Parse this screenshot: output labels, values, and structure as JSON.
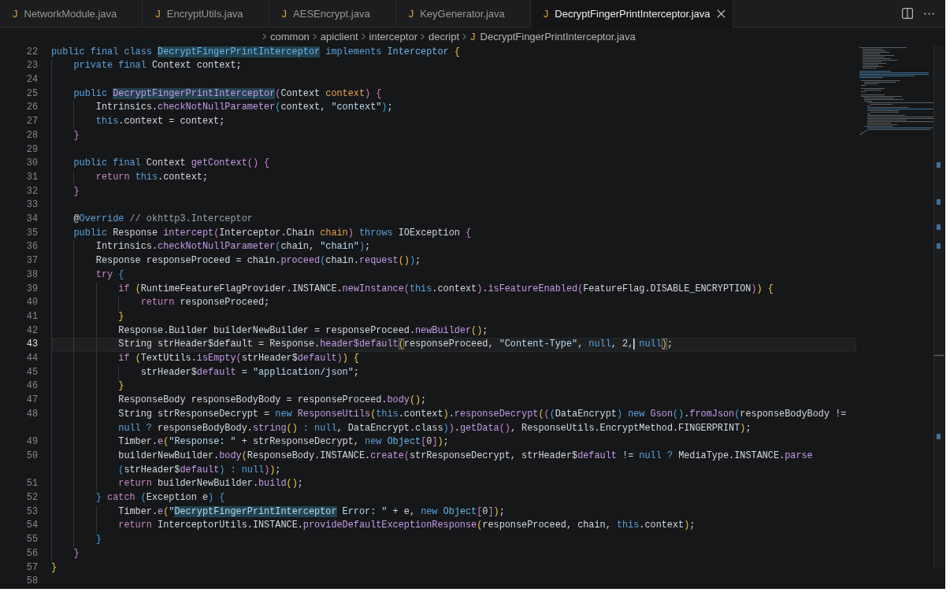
{
  "tabs": [
    {
      "file_icon": "J",
      "label": "NetworkModule.java",
      "selected": false
    },
    {
      "file_icon": "J",
      "label": "EncryptUtils.java",
      "selected": false
    },
    {
      "file_icon": "J",
      "label": "AESEncrypt.java",
      "selected": false
    },
    {
      "file_icon": "J",
      "label": "KeyGenerator.java",
      "selected": false
    },
    {
      "file_icon": "J",
      "label": "DecryptFingerPrintInterceptor.java",
      "selected": true
    }
  ],
  "breadcrumbs": [
    {
      "label": "common"
    },
    {
      "label": "apiclient"
    },
    {
      "label": "interceptor"
    },
    {
      "label": "decript"
    },
    {
      "file_icon": "J",
      "label": "DecryptFingerPrintInterceptor.java"
    }
  ],
  "editor": {
    "lines": [
      {
        "number": "22",
        "current": false,
        "rows": [
          {
            "tokens": [
              {
                "text": "public final class ",
                "kind": "keyword"
              },
              {
                "text": "DecryptFingerPrintInterceptor",
                "kind": "type",
                "highlighted": true
              },
              {
                "text": " implements ",
                "kind": "keyword"
              },
              {
                "text": "Interceptor ",
                "kind": "type"
              },
              {
                "text": "{",
                "kind": "bracket1"
              }
            ]
          }
        ]
      },
      {
        "number": "23",
        "current": false,
        "rows": [
          {
            "tokens": [
              {
                "text": "    private final ",
                "kind": "keyword"
              },
              {
                "text": "Context context;",
                "kind": "plain"
              }
            ]
          }
        ]
      },
      {
        "number": "24",
        "current": false
      },
      {
        "number": "25",
        "current": false,
        "rows": [
          {
            "tokens": [
              {
                "text": "    public ",
                "kind": "keyword"
              },
              {
                "text": "DecryptFingerPrintInterceptor",
                "kind": "function",
                "highlighted": true
              },
              {
                "text": "(",
                "kind": "bracket2"
              },
              {
                "text": "Context ",
                "kind": "plain"
              },
              {
                "text": "context",
                "kind": "param"
              },
              {
                "text": ") {",
                "kind": "bracket2"
              }
            ]
          }
        ]
      },
      {
        "number": "26",
        "current": false,
        "rows": [
          {
            "tokens": [
              {
                "text": "        Intrinsics.",
                "kind": "plain"
              },
              {
                "text": "checkNotNullParameter",
                "kind": "function"
              },
              {
                "text": "(",
                "kind": "bracket3"
              },
              {
                "text": "context, ",
                "kind": "plain"
              },
              {
                "text": "\"context\"",
                "kind": "string"
              },
              {
                "text": ")",
                "kind": "bracket3"
              },
              {
                "text": ";",
                "kind": "plain"
              }
            ]
          }
        ]
      },
      {
        "number": "27",
        "current": false,
        "rows": [
          {
            "tokens": [
              {
                "text": "        this",
                "kind": "keyword"
              },
              {
                "text": ".context = context;",
                "kind": "plain"
              }
            ]
          }
        ]
      },
      {
        "number": "28",
        "current": false,
        "rows": [
          {
            "tokens": [
              {
                "text": "    }",
                "kind": "bracket2"
              }
            ]
          }
        ]
      },
      {
        "number": "29",
        "current": false
      },
      {
        "number": "30",
        "current": false,
        "rows": [
          {
            "tokens": [
              {
                "text": "    public final ",
                "kind": "keyword"
              },
              {
                "text": "Context ",
                "kind": "plain"
              },
              {
                "text": "getContext",
                "kind": "function"
              },
              {
                "text": "() {",
                "kind": "bracket2"
              }
            ]
          }
        ]
      },
      {
        "number": "31",
        "current": false,
        "rows": [
          {
            "tokens": [
              {
                "text": "        return ",
                "kind": "control"
              },
              {
                "text": "this",
                "kind": "keyword"
              },
              {
                "text": ".context;",
                "kind": "plain"
              }
            ]
          }
        ]
      },
      {
        "number": "32",
        "current": false,
        "rows": [
          {
            "tokens": [
              {
                "text": "    }",
                "kind": "bracket2"
              }
            ]
          }
        ]
      },
      {
        "number": "33",
        "current": false
      },
      {
        "number": "34",
        "current": false,
        "rows": [
          {
            "tokens": [
              {
                "text": "    @",
                "kind": "plain"
              },
              {
                "text": "Override ",
                "kind": "keyword"
              },
              {
                "text": "// okhttp3.Interceptor",
                "kind": "comment"
              }
            ]
          }
        ]
      },
      {
        "number": "35",
        "current": false,
        "rows": [
          {
            "tokens": [
              {
                "text": "    public ",
                "kind": "keyword"
              },
              {
                "text": "Response ",
                "kind": "plain"
              },
              {
                "text": "intercept",
                "kind": "function"
              },
              {
                "text": "(",
                "kind": "bracket2"
              },
              {
                "text": "Interceptor.Chain ",
                "kind": "plain"
              },
              {
                "text": "chain",
                "kind": "param"
              },
              {
                "text": ")",
                "kind": "bracket2"
              },
              {
                "text": " throws ",
                "kind": "keyword"
              },
              {
                "text": "IOException ",
                "kind": "plain"
              },
              {
                "text": "{",
                "kind": "bracket2"
              }
            ]
          }
        ]
      },
      {
        "number": "36",
        "current": false,
        "rows": [
          {
            "tokens": [
              {
                "text": "        Intrinsics.",
                "kind": "plain"
              },
              {
                "text": "checkNotNullParameter",
                "kind": "function"
              },
              {
                "text": "(",
                "kind": "bracket3"
              },
              {
                "text": "chain, ",
                "kind": "plain"
              },
              {
                "text": "\"chain\"",
                "kind": "string"
              },
              {
                "text": ")",
                "kind": "bracket3"
              },
              {
                "text": ";",
                "kind": "plain"
              }
            ]
          }
        ]
      },
      {
        "number": "37",
        "current": false,
        "rows": [
          {
            "tokens": [
              {
                "text": "        Response responseProceed = chain.",
                "kind": "plain"
              },
              {
                "text": "proceed",
                "kind": "function"
              },
              {
                "text": "(",
                "kind": "bracket3"
              },
              {
                "text": "chain.",
                "kind": "plain"
              },
              {
                "text": "request",
                "kind": "function"
              },
              {
                "text": "()",
                "kind": "bracket1"
              },
              {
                "text": ")",
                "kind": "bracket3"
              },
              {
                "text": ";",
                "kind": "plain"
              }
            ]
          }
        ]
      },
      {
        "number": "38",
        "current": false,
        "rows": [
          {
            "tokens": [
              {
                "text": "        try ",
                "kind": "control"
              },
              {
                "text": "{",
                "kind": "bracket3"
              }
            ]
          }
        ]
      },
      {
        "number": "39",
        "current": false,
        "rows": [
          {
            "tokens": [
              {
                "text": "            if ",
                "kind": "control"
              },
              {
                "text": "(",
                "kind": "bracket1"
              },
              {
                "text": "RuntimeFeatureFlagProvider.INSTANCE.",
                "kind": "plain"
              },
              {
                "text": "newInstance",
                "kind": "function"
              },
              {
                "text": "(",
                "kind": "bracket2"
              },
              {
                "text": "this",
                "kind": "keyword"
              },
              {
                "text": ".context",
                "kind": "plain"
              },
              {
                "text": ")",
                "kind": "bracket2"
              },
              {
                "text": ".",
                "kind": "plain"
              },
              {
                "text": "isFeatureEnabled",
                "kind": "function"
              },
              {
                "text": "(",
                "kind": "bracket2"
              },
              {
                "text": "FeatureFlag.DISABLE_ENCRYPTION",
                "kind": "plain"
              },
              {
                "text": ")",
                "kind": "bracket2"
              },
              {
                "text": ") {",
                "kind": "bracket1"
              }
            ]
          }
        ]
      },
      {
        "number": "40",
        "current": false,
        "rows": [
          {
            "tokens": [
              {
                "text": "                return ",
                "kind": "control"
              },
              {
                "text": "responseProceed;",
                "kind": "plain"
              }
            ]
          }
        ]
      },
      {
        "number": "41",
        "current": false,
        "rows": [
          {
            "tokens": [
              {
                "text": "            }",
                "kind": "bracket1"
              }
            ]
          }
        ]
      },
      {
        "number": "42",
        "current": false,
        "rows": [
          {
            "tokens": [
              {
                "text": "            Response.Builder builderNewBuilder = responseProceed.",
                "kind": "plain"
              },
              {
                "text": "newBuilder",
                "kind": "function"
              },
              {
                "text": "()",
                "kind": "bracket1"
              },
              {
                "text": ";",
                "kind": "plain"
              }
            ]
          }
        ]
      },
      {
        "number": "43",
        "current": true,
        "rows": [
          {
            "tokens": [
              {
                "text": "            String strHeader$default = Response.",
                "kind": "plain"
              },
              {
                "text": "header$default",
                "kind": "function"
              },
              {
                "text": "(",
                "kind": "bracket1",
                "matched": true
              },
              {
                "text": "responseProceed, ",
                "kind": "plain"
              },
              {
                "text": "\"Content-Type\"",
                "kind": "string"
              },
              {
                "text": ", ",
                "kind": "plain"
              },
              {
                "text": "null",
                "kind": "keyword"
              },
              {
                "text": ", 2,",
                "kind": "plain"
              },
              {
                "text": " null",
                "kind": "keyword",
                "cursor": true
              },
              {
                "text": ")",
                "kind": "bracket1",
                "matched": true
              },
              {
                "text": ";",
                "kind": "plain"
              }
            ]
          }
        ]
      },
      {
        "number": "44",
        "current": false,
        "rows": [
          {
            "tokens": [
              {
                "text": "            if ",
                "kind": "control"
              },
              {
                "text": "(",
                "kind": "bracket1"
              },
              {
                "text": "TextUtils.",
                "kind": "plain"
              },
              {
                "text": "isEmpty",
                "kind": "function"
              },
              {
                "text": "(",
                "kind": "bracket2"
              },
              {
                "text": "strHeader$",
                "kind": "plain"
              },
              {
                "text": "default",
                "kind": "function"
              },
              {
                "text": ")",
                "kind": "bracket2"
              },
              {
                "text": ") {",
                "kind": "bracket1"
              }
            ]
          }
        ]
      },
      {
        "number": "45",
        "current": false,
        "rows": [
          {
            "tokens": [
              {
                "text": "                strHeader$",
                "kind": "plain"
              },
              {
                "text": "default",
                "kind": "function"
              },
              {
                "text": " = ",
                "kind": "plain"
              },
              {
                "text": "\"application/json\"",
                "kind": "string"
              },
              {
                "text": ";",
                "kind": "plain"
              }
            ]
          }
        ]
      },
      {
        "number": "46",
        "current": false,
        "rows": [
          {
            "tokens": [
              {
                "text": "            }",
                "kind": "bracket1"
              }
            ]
          }
        ]
      },
      {
        "number": "47",
        "current": false,
        "rows": [
          {
            "tokens": [
              {
                "text": "            ResponseBody responseBodyBody = responseProceed.",
                "kind": "plain"
              },
              {
                "text": "body",
                "kind": "function"
              },
              {
                "text": "()",
                "kind": "bracket1"
              },
              {
                "text": ";",
                "kind": "plain"
              }
            ]
          }
        ]
      },
      {
        "number": "48",
        "current": false,
        "rows": [
          {
            "tokens": [
              {
                "text": "            String strResponseDecrypt = ",
                "kind": "plain"
              },
              {
                "text": "new ",
                "kind": "keyword"
              },
              {
                "text": "ResponseUtils",
                "kind": "function"
              },
              {
                "text": "(",
                "kind": "bracket1"
              },
              {
                "text": "this",
                "kind": "keyword"
              },
              {
                "text": ".context",
                "kind": "plain"
              },
              {
                "text": ")",
                "kind": "bracket1"
              },
              {
                "text": ".",
                "kind": "plain"
              },
              {
                "text": "responseDecrypt",
                "kind": "function"
              },
              {
                "text": "(",
                "kind": "bracket1"
              },
              {
                "text": "(",
                "kind": "bracket2"
              },
              {
                "text": "(",
                "kind": "bracket3"
              },
              {
                "text": "DataEncrypt",
                "kind": "plain"
              },
              {
                "text": ") ",
                "kind": "bracket3"
              },
              {
                "text": "new ",
                "kind": "keyword"
              },
              {
                "text": "Gson",
                "kind": "function"
              },
              {
                "text": "()",
                "kind": "bracket3"
              },
              {
                "text": ".",
                "kind": "plain"
              },
              {
                "text": "fromJson",
                "kind": "function"
              },
              {
                "text": "(",
                "kind": "bracket3"
              },
              {
                "text": "responseBodyBody !=",
                "kind": "plain"
              }
            ]
          },
          {
            "tokens": [
              {
                "text": "null ? ",
                "kind": "keyword"
              },
              {
                "text": "responseBodyBody.",
                "kind": "plain"
              },
              {
                "text": "string",
                "kind": "function"
              },
              {
                "text": "()",
                "kind": "bracket1"
              },
              {
                "text": " : null",
                "kind": "keyword"
              },
              {
                "text": ", DataEncrypt.class",
                "kind": "plain"
              },
              {
                "text": ")",
                "kind": "bracket3"
              },
              {
                "text": ")",
                "kind": "bracket2"
              },
              {
                "text": ".",
                "kind": "plain"
              },
              {
                "text": "getData",
                "kind": "function"
              },
              {
                "text": "()",
                "kind": "bracket2"
              },
              {
                "text": ", ResponseUtils.EncryptMethod.FINGERPRINT",
                "kind": "plain"
              },
              {
                "text": ")",
                "kind": "bracket1"
              },
              {
                "text": ";",
                "kind": "plain"
              }
            ]
          }
        ]
      },
      {
        "number": "49",
        "current": false,
        "rows": [
          {
            "tokens": [
              {
                "text": "            Timber.",
                "kind": "plain"
              },
              {
                "text": "e",
                "kind": "function"
              },
              {
                "text": "(",
                "kind": "bracket1"
              },
              {
                "text": "\"Response: \"",
                "kind": "string"
              },
              {
                "text": " + strResponseDecrypt, ",
                "kind": "plain"
              },
              {
                "text": "new ",
                "kind": "keyword"
              },
              {
                "text": "Object",
                "kind": "type"
              },
              {
                "text": "[",
                "kind": "bracket2"
              },
              {
                "text": "0",
                "kind": "plain"
              },
              {
                "text": "]",
                "kind": "bracket2"
              },
              {
                "text": ")",
                "kind": "bracket1"
              },
              {
                "text": ";",
                "kind": "plain"
              }
            ]
          }
        ]
      },
      {
        "number": "50",
        "current": false,
        "rows": [
          {
            "tokens": [
              {
                "text": "            builderNewBuilder.",
                "kind": "plain"
              },
              {
                "text": "body",
                "kind": "function"
              },
              {
                "text": "(",
                "kind": "bracket1"
              },
              {
                "text": "ResponseBody.INSTANCE.",
                "kind": "plain"
              },
              {
                "text": "create",
                "kind": "function"
              },
              {
                "text": "(",
                "kind": "bracket2"
              },
              {
                "text": "strResponseDecrypt, strHeader$",
                "kind": "plain"
              },
              {
                "text": "default",
                "kind": "function"
              },
              {
                "text": " != ",
                "kind": "plain"
              },
              {
                "text": "null ? ",
                "kind": "keyword"
              },
              {
                "text": "MediaType.INSTANCE.",
                "kind": "plain"
              },
              {
                "text": "parse",
                "kind": "function"
              }
            ]
          },
          {
            "tokens": [
              {
                "text": "(",
                "kind": "bracket3"
              },
              {
                "text": "strHeader$",
                "kind": "plain"
              },
              {
                "text": "default",
                "kind": "function"
              },
              {
                "text": ")",
                "kind": "bracket3"
              },
              {
                "text": " : null",
                "kind": "keyword"
              },
              {
                "text": ")",
                "kind": "bracket2"
              },
              {
                "text": ")",
                "kind": "bracket1"
              },
              {
                "text": ";",
                "kind": "plain"
              }
            ]
          }
        ]
      },
      {
        "number": "51",
        "current": false,
        "rows": [
          {
            "tokens": [
              {
                "text": "            return ",
                "kind": "control"
              },
              {
                "text": "builderNewBuilder.",
                "kind": "plain"
              },
              {
                "text": "build",
                "kind": "function"
              },
              {
                "text": "()",
                "kind": "bracket1"
              },
              {
                "text": ";",
                "kind": "plain"
              }
            ]
          }
        ]
      },
      {
        "number": "52",
        "current": false,
        "rows": [
          {
            "tokens": [
              {
                "text": "        }",
                "kind": "bracket3"
              },
              {
                "text": " catch ",
                "kind": "control"
              },
              {
                "text": "(",
                "kind": "bracket3"
              },
              {
                "text": "Exception e",
                "kind": "plain"
              },
              {
                "text": ") {",
                "kind": "bracket3"
              }
            ]
          }
        ]
      },
      {
        "number": "53",
        "current": false,
        "rows": [
          {
            "tokens": [
              {
                "text": "            Timber.",
                "kind": "plain"
              },
              {
                "text": "e",
                "kind": "function"
              },
              {
                "text": "(",
                "kind": "bracket1"
              },
              {
                "text": "\"",
                "kind": "string"
              },
              {
                "text": "DecryptFingerPrintInterceptor",
                "kind": "string",
                "highlighted": true
              },
              {
                "text": " Error: \"",
                "kind": "string"
              },
              {
                "text": " + e, ",
                "kind": "plain"
              },
              {
                "text": "new ",
                "kind": "keyword"
              },
              {
                "text": "Object",
                "kind": "type"
              },
              {
                "text": "[",
                "kind": "bracket2"
              },
              {
                "text": "0",
                "kind": "plain"
              },
              {
                "text": "]",
                "kind": "bracket2"
              },
              {
                "text": ")",
                "kind": "bracket1"
              },
              {
                "text": ";",
                "kind": "plain"
              }
            ]
          }
        ]
      },
      {
        "number": "54",
        "current": false,
        "rows": [
          {
            "tokens": [
              {
                "text": "            return ",
                "kind": "control"
              },
              {
                "text": "InterceptorUtils.INSTANCE.",
                "kind": "plain"
              },
              {
                "text": "provideDefaultExceptionResponse",
                "kind": "function"
              },
              {
                "text": "(",
                "kind": "bracket1"
              },
              {
                "text": "responseProceed, chain, ",
                "kind": "plain"
              },
              {
                "text": "this",
                "kind": "keyword"
              },
              {
                "text": ".context",
                "kind": "plain"
              },
              {
                "text": ")",
                "kind": "bracket1"
              },
              {
                "text": ";",
                "kind": "plain"
              }
            ]
          }
        ]
      },
      {
        "number": "55",
        "current": false,
        "rows": [
          {
            "tokens": [
              {
                "text": "        }",
                "kind": "bracket3"
              }
            ]
          }
        ]
      },
      {
        "number": "56",
        "current": false,
        "rows": [
          {
            "tokens": [
              {
                "text": "    }",
                "kind": "bracket2"
              }
            ]
          }
        ]
      },
      {
        "number": "57",
        "current": false,
        "rows": [
          {
            "tokens": [
              {
                "text": "}",
                "kind": "bracket1"
              }
            ]
          }
        ]
      },
      {
        "number": "58",
        "current": false
      }
    ]
  }
}
